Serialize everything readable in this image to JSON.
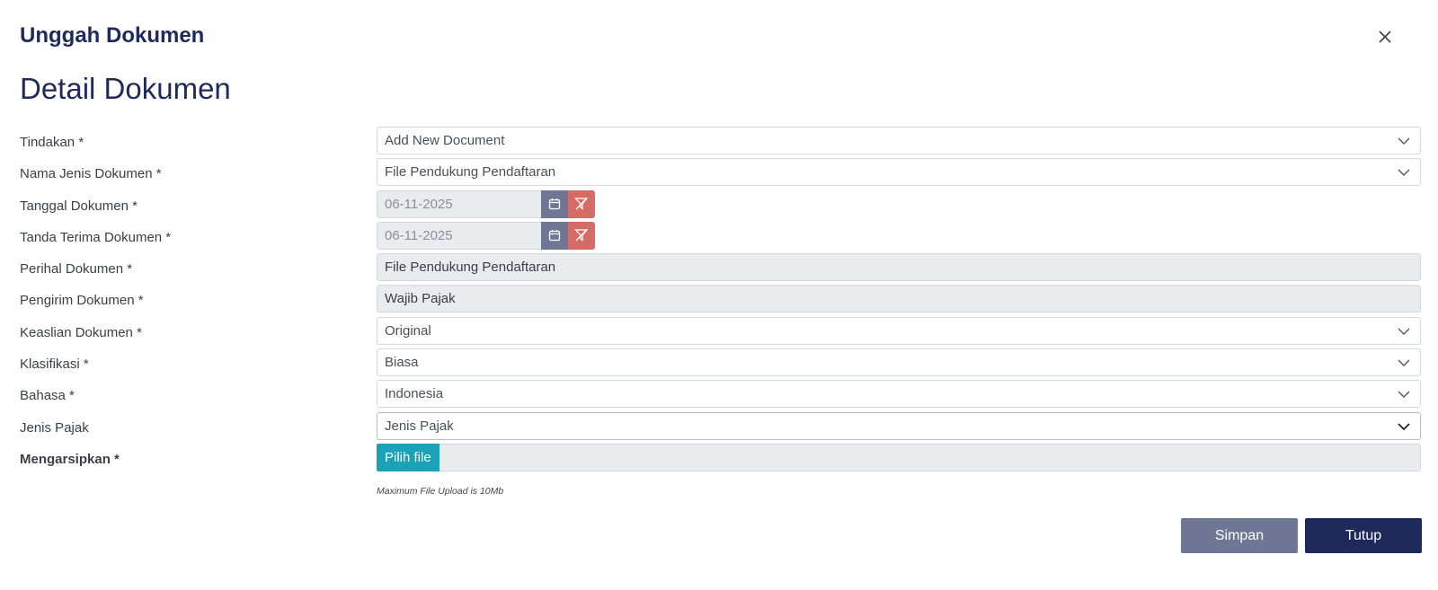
{
  "modal": {
    "title": "Unggah Dokumen",
    "section_title": "Detail Dokumen"
  },
  "form": {
    "tindakan": {
      "label": "Tindakan *",
      "value": "Add New Document"
    },
    "nama_jenis": {
      "label": "Nama Jenis Dokumen *",
      "value": "File Pendukung Pendaftaran"
    },
    "tanggal": {
      "label": "Tanggal Dokumen *",
      "value": "06-11-2025"
    },
    "tanda_terima": {
      "label": "Tanda Terima Dokumen *",
      "value": "06-11-2025"
    },
    "perihal": {
      "label": "Perihal Dokumen *",
      "value": "File Pendukung Pendaftaran"
    },
    "pengirim": {
      "label": "Pengirim Dokumen *",
      "value": "Wajib Pajak"
    },
    "keaslian": {
      "label": "Keaslian Dokumen *",
      "value": "Original"
    },
    "klasifikasi": {
      "label": "Klasifikasi *",
      "value": "Biasa"
    },
    "bahasa": {
      "label": "Bahasa *",
      "value": "Indonesia"
    },
    "jenis_pajak": {
      "label": "Jenis Pajak",
      "placeholder": "Jenis Pajak"
    },
    "mengarsipkan": {
      "label": "Mengarsipkan *",
      "button": "Pilih file"
    },
    "upload_hint": "Maximum File Upload is 10Mb"
  },
  "actions": {
    "save_label": "Simpan",
    "close_label": "Tutup"
  },
  "icons": {
    "close": "close-icon",
    "dropdown": "chevron-down-icon",
    "calendar": "calendar-icon",
    "clear": "filter-clear-icon"
  },
  "colors": {
    "title": "#1f2a5c",
    "save_button": "#6f7794",
    "close_button": "#1f2a5c",
    "calendar_button": "#6f7794",
    "clear_button": "#d66b66",
    "file_button": "#1aa2b8",
    "readonly_bg": "#e9ecef"
  }
}
